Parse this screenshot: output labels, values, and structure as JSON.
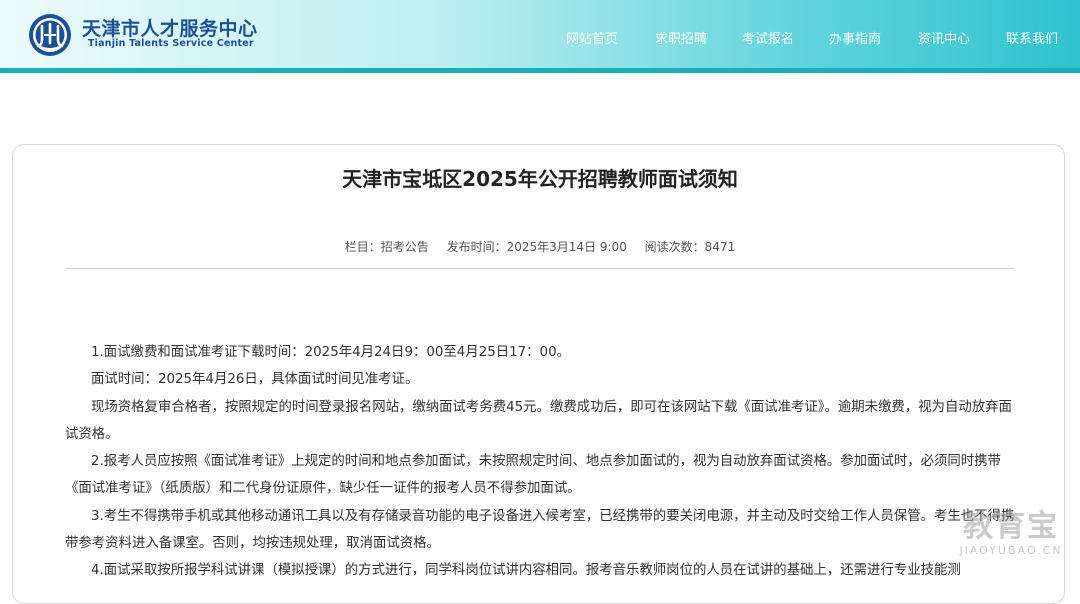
{
  "header": {
    "logo_cn": "天津市人才服务中心",
    "logo_en": "Tianjin Talents Service Center",
    "nav": [
      {
        "label": "网站首页"
      },
      {
        "label": "求职招聘"
      },
      {
        "label": "考试报名"
      },
      {
        "label": "办事指南"
      },
      {
        "label": "资讯中心"
      },
      {
        "label": "联系我们"
      }
    ]
  },
  "article": {
    "title": "天津市宝坻区2025年公开招聘教师面试须知",
    "meta": {
      "column": "栏目：招考公告",
      "published": "发布时间：2025年3月14日 9:00",
      "views": "阅读次数：8471"
    },
    "paragraphs": [
      "1.面试缴费和面试准考证下载时间：2025年4月24日9：00至4月25日17：00。",
      "面试时间：2025年4月26日，具体面试时间见准考证。",
      "现场资格复审合格者，按照规定的时间登录报名网站，缴纳面试考务费45元。缴费成功后，即可在该网站下载《面试准考证》。逾期未缴费，视为自动放弃面试资格。",
      "2.报考人员应按照《面试准考证》上规定的时间和地点参加面试，未按照规定时间、地点参加面试的，视为自动放弃面试资格。参加面试时，必须同时携带《面试准考证》（纸质版）和二代身份证原件，缺少任一证件的报考人员不得参加面试。",
      "3.考生不得携带手机或其他移动通讯工具以及有存储录音功能的电子设备进入候考室，已经携带的要关闭电源，并主动及时交给工作人员保管。考生也不得携带参考资料进入备课室。否则，均按违规处理，取消面试资格。",
      "4.面试采取按所报学科试讲课（模拟授课）的方式进行，同学科岗位试讲内容相同。报考音乐教师岗位的人员在试讲的基础上，还需进行专业技能测"
    ]
  },
  "watermark": {
    "cn": "教育宝",
    "en": "JIAOYUBAO.CN"
  },
  "colors": {
    "header_gradient_start": "#ecfbfb",
    "header_gradient_end": "#2fc3cf",
    "header_bar": "#1aaeb8",
    "logo_text": "#1d4f97"
  }
}
